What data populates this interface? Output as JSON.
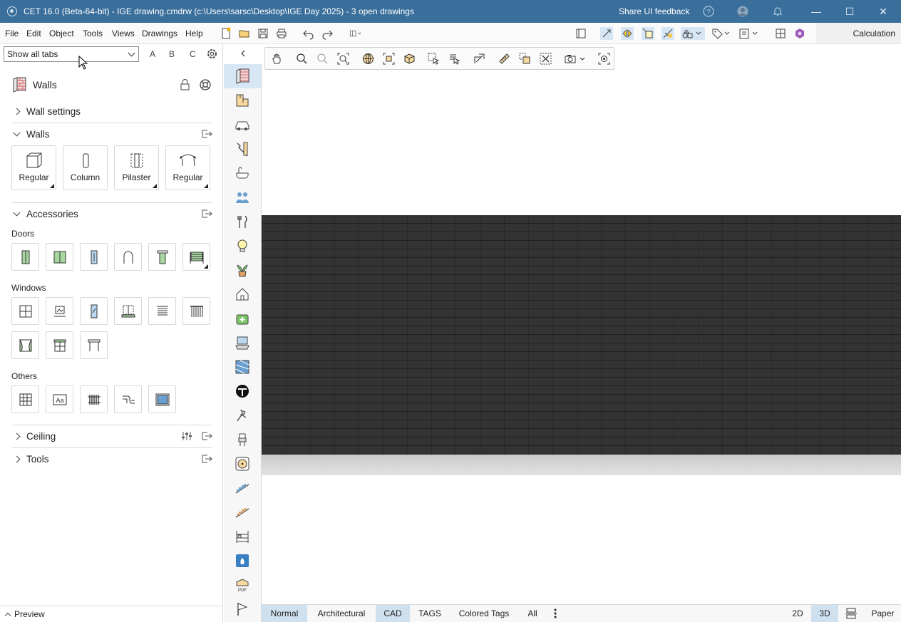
{
  "window": {
    "title": "CET 16.0 (Beta-64-bit) - IGE drawing.cmdrw (c:\\Users\\sarsc\\Desktop\\IGE Day 2025) - 3  open drawings",
    "feedback": "Share UI feedback"
  },
  "menu": [
    "File",
    "Edit",
    "Object",
    "Tools",
    "Views",
    "Drawings",
    "Help"
  ],
  "toolbar": {
    "calculation": "Calculation"
  },
  "left_panel": {
    "tab_select": "Show all tabs",
    "letters": [
      "A",
      "B",
      "C"
    ],
    "header": "Walls",
    "sections": {
      "wall_settings": "Wall settings",
      "walls": "Walls",
      "accessories": "Accessories",
      "ceiling": "Ceiling",
      "tools": "Tools"
    },
    "wall_tiles": [
      "Regular",
      "Column",
      "Pilaster",
      "Regular"
    ],
    "subheads": {
      "doors": "Doors",
      "windows": "Windows",
      "others": "Others"
    },
    "preview": "Preview"
  },
  "bottom_tabs": [
    "Normal",
    "Architectural",
    "CAD",
    "TAGS",
    "Colored Tags",
    "All"
  ],
  "view_modes": [
    "2D",
    "3D",
    "Paper"
  ],
  "colors": {
    "titlebar": "#3a6f9c",
    "selected_tab": "#cfe0ef",
    "wall": "#333333"
  }
}
